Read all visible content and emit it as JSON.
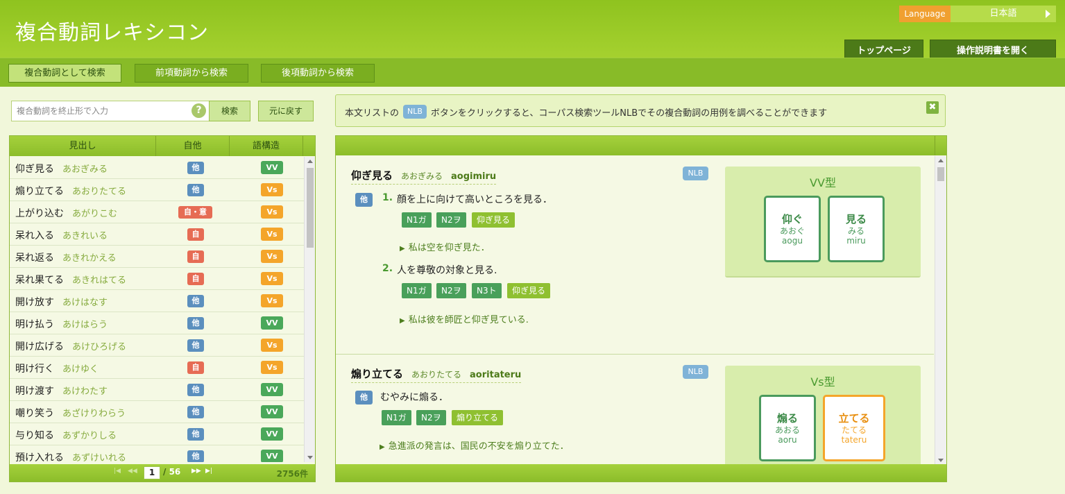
{
  "header": {
    "title": "複合動詞レキシコン",
    "language_label": "Language",
    "language_value": "日本語",
    "top_page": "トップページ",
    "manual": "操作説明書を開く"
  },
  "tabs": [
    "複合動詞として検索",
    "前項動詞から検索",
    "後項動詞から検索"
  ],
  "search": {
    "placeholder": "複合動詞を終止形で入力",
    "help_glyph": "?",
    "search_label": "検索",
    "reset_label": "元に戻す"
  },
  "notice": {
    "pre": "本文リストの",
    "nlb": "NLB",
    "post": "ボタンをクリックすると、コーパス検索ツールNLBでその複合動詞の用例を調べることができます",
    "close_glyph": "✖"
  },
  "list": {
    "columns": [
      "見出し",
      "自他",
      "語構造"
    ],
    "rows": [
      {
        "word": "仰ぎ見る",
        "kana": "あおぎみる",
        "ta": "他",
        "ta_kind": "he",
        "st": "VV",
        "st_kind": "vv"
      },
      {
        "word": "煽り立てる",
        "kana": "あおりたてる",
        "ta": "他",
        "ta_kind": "he",
        "st": "Vs",
        "st_kind": "vs"
      },
      {
        "word": "上がり込む",
        "kana": "あがりこむ",
        "ta": "自・意",
        "ta_kind": "jiu",
        "st": "Vs",
        "st_kind": "vs"
      },
      {
        "word": "呆れ入る",
        "kana": "あきれいる",
        "ta": "自",
        "ta_kind": "ji",
        "st": "Vs",
        "st_kind": "vs"
      },
      {
        "word": "呆れ返る",
        "kana": "あきれかえる",
        "ta": "自",
        "ta_kind": "ji",
        "st": "Vs",
        "st_kind": "vs"
      },
      {
        "word": "呆れ果てる",
        "kana": "あきれはてる",
        "ta": "自",
        "ta_kind": "ji",
        "st": "Vs",
        "st_kind": "vs"
      },
      {
        "word": "開け放す",
        "kana": "あけはなす",
        "ta": "他",
        "ta_kind": "he",
        "st": "Vs",
        "st_kind": "vs"
      },
      {
        "word": "明け払う",
        "kana": "あけはらう",
        "ta": "他",
        "ta_kind": "he",
        "st": "VV",
        "st_kind": "vv"
      },
      {
        "word": "開け広げる",
        "kana": "あけひろげる",
        "ta": "他",
        "ta_kind": "he",
        "st": "Vs",
        "st_kind": "vs"
      },
      {
        "word": "明け行く",
        "kana": "あけゆく",
        "ta": "自",
        "ta_kind": "ji",
        "st": "Vs",
        "st_kind": "vs"
      },
      {
        "word": "明け渡す",
        "kana": "あけわたす",
        "ta": "他",
        "ta_kind": "he",
        "st": "VV",
        "st_kind": "vv"
      },
      {
        "word": "嘲り笑う",
        "kana": "あざけりわらう",
        "ta": "他",
        "ta_kind": "he",
        "st": "VV",
        "st_kind": "vv"
      },
      {
        "word": "与り知る",
        "kana": "あずかりしる",
        "ta": "他",
        "ta_kind": "he",
        "st": "VV",
        "st_kind": "vv"
      },
      {
        "word": "預け入れる",
        "kana": "あずけいれる",
        "ta": "他",
        "ta_kind": "he",
        "st": "VV",
        "st_kind": "vv"
      }
    ]
  },
  "pager": {
    "first": "|◀",
    "prev": "◀◀",
    "next": "▶▶",
    "last": "▶|",
    "current": "1",
    "separator": "/",
    "total": "56",
    "count": "2756件"
  },
  "entries": [
    {
      "word": "仰ぎ見る",
      "kana": "あおぎみる",
      "romaji": "aogimiru",
      "nlb": "NLB",
      "ta": "他",
      "senses": [
        {
          "num": "1.",
          "text": "顔を上に向けて高いところを見る．",
          "tags": [
            "N1ガ",
            "N2ヲ"
          ],
          "vtag": "仰ぎ見る",
          "example": "私は空を仰ぎ見た．"
        },
        {
          "num": "2.",
          "text": "人を尊敬の対象と見る.",
          "tags": [
            "N1ガ",
            "N2ヲ",
            "N3ト"
          ],
          "vtag": "仰ぎ見る",
          "example": "私は彼を師匠と仰ぎ見ている."
        }
      ],
      "type": "VV型",
      "v1": {
        "head": "仰ぐ",
        "kana": "あおぐ",
        "romaji": "aogu"
      },
      "v2": {
        "head": "見る",
        "kana": "みる",
        "romaji": "miru"
      }
    },
    {
      "word": "煽り立てる",
      "kana": "あおりたてる",
      "romaji": "aoritateru",
      "nlb": "NLB",
      "ta": "他",
      "senses": [
        {
          "num": "",
          "text": "むやみに煽る．",
          "tags": [
            "N1ガ",
            "N2ヲ"
          ],
          "vtag": "煽り立てる",
          "example": "急進派の発言は、国民の不安を煽り立てた．"
        }
      ],
      "type": "Vs型",
      "v1": {
        "head": "煽る",
        "kana": "あおる",
        "romaji": "aoru"
      },
      "v2": {
        "head": "立てる",
        "kana": "たてる",
        "romaji": "tateru"
      }
    }
  ],
  "icons": {
    "help": "help-circle-icon",
    "close": "close-icon",
    "lang_arrow": "triangle-right-icon",
    "example_marker": "triangle-right-icon"
  },
  "colors": {
    "header_green": "#8fc31f",
    "tag_blue": "#5b8fbe",
    "tag_red": "#e66c54",
    "vv_green": "#4aa85a",
    "vs_orange": "#f4a52a"
  }
}
